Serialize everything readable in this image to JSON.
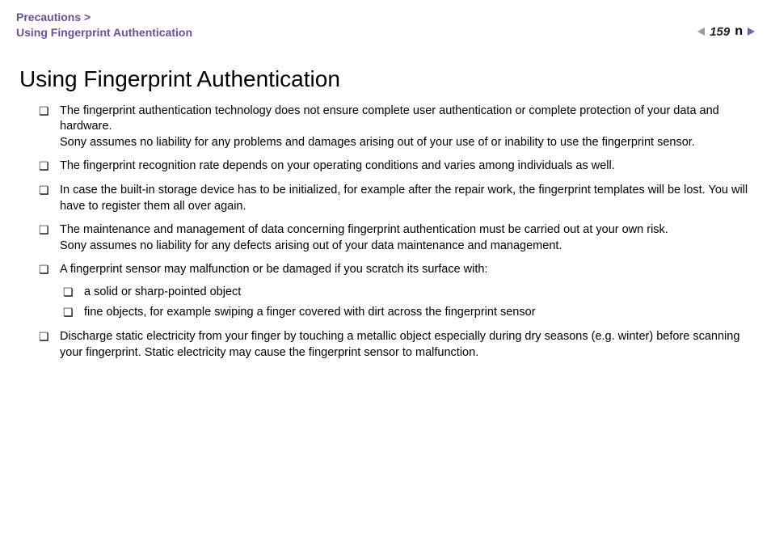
{
  "header": {
    "breadcrumb_line1": "Precautions >",
    "breadcrumb_line2": "Using Fingerprint Authentication",
    "page_number": "159",
    "n_marker": "n"
  },
  "title": "Using Fingerprint Authentication",
  "bullets": [
    {
      "text": "The fingerprint authentication technology does not ensure complete user authentication or complete protection of your data and hardware.\nSony assumes no liability for any problems and damages arising out of your use of or inability to use the fingerprint sensor."
    },
    {
      "text": "The fingerprint recognition rate depends on your operating conditions and varies among individuals as well."
    },
    {
      "text": "In case the built-in storage device has to be initialized, for example after the repair work, the fingerprint templates will be lost. You will have to register them all over again."
    },
    {
      "text": "The maintenance and management of data concerning fingerprint authentication must be carried out at your own risk.\nSony assumes no liability for any defects arising out of your data maintenance and management."
    },
    {
      "text": "A fingerprint sensor may malfunction or be damaged if you scratch its surface with:",
      "sub": [
        "a solid or sharp-pointed object",
        "fine objects, for example swiping a finger covered with dirt across the fingerprint sensor"
      ]
    },
    {
      "text": "Discharge static electricity from your finger by touching a metallic object especially during dry seasons (e.g. winter) before scanning your fingerprint. Static electricity may cause the fingerprint sensor to malfunction."
    }
  ]
}
